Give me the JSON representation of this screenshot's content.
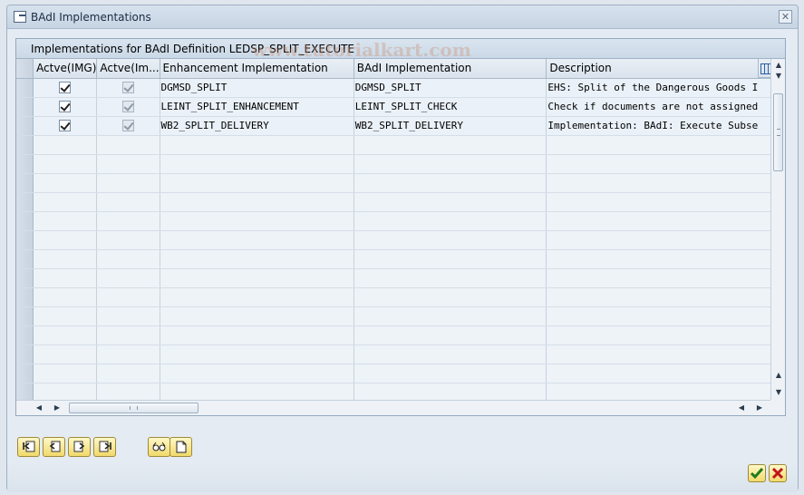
{
  "window": {
    "title": "BAdI Implementations"
  },
  "panel": {
    "title": "Implementations for BAdI Definition LEDSP_SPLIT_EXECUTE",
    "watermark": "www.tutorialkart.com"
  },
  "table": {
    "columns": [
      "Actve(IMG)",
      "Actve(Im...",
      "Enhancement Implementation",
      "BAdI Implementation",
      "Description"
    ],
    "rows": [
      {
        "active_img": true,
        "active_impl": true,
        "enh_impl": "DGMSD_SPLIT",
        "badi_impl": "DGMSD_SPLIT",
        "description": "EHS: Split of the Dangerous Goods I"
      },
      {
        "active_img": true,
        "active_impl": true,
        "enh_impl": "LEINT_SPLIT_ENHANCEMENT",
        "badi_impl": "LEINT_SPLIT_CHECK",
        "description": "Check if documents are not assigned"
      },
      {
        "active_img": true,
        "active_impl": true,
        "enh_impl": "WB2_SPLIT_DELIVERY",
        "badi_impl": "WB2_SPLIT_DELIVERY",
        "description": "Implementation: BAdI: Execute Subse"
      }
    ],
    "empty_rows": 14
  },
  "icons": {
    "close": "close-icon",
    "column_settings": "column-settings-icon",
    "ok": "check-icon",
    "cancel": "cancel-icon"
  },
  "colors": {
    "accent": "#2b5ea8",
    "button_yellow": "#f1d96b"
  }
}
